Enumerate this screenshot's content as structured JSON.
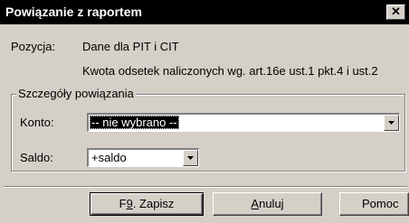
{
  "window": {
    "title": "Powiązanie z raportem",
    "close_label": "✕"
  },
  "position": {
    "label": "Pozycja:",
    "line1": "Dane dla PIT i CIT",
    "line2": "Kwota odsetek naliczonych wg. art.16e ust.1 pkt.4 i ust.2"
  },
  "details": {
    "legend": "Szczegóły powiązania",
    "konto_label": "Konto:",
    "konto_value": "-- nie wybrano --",
    "saldo_label": "Saldo:",
    "saldo_value": "+saldo"
  },
  "buttons": {
    "save_pre": "F",
    "save_key": "9",
    "save_post": ". Zapisz",
    "cancel_key": "A",
    "cancel_rest": "nuluj",
    "help": "Pomoc"
  },
  "icons": {
    "close": "close-icon",
    "dropdown": "chevron-down-icon"
  }
}
